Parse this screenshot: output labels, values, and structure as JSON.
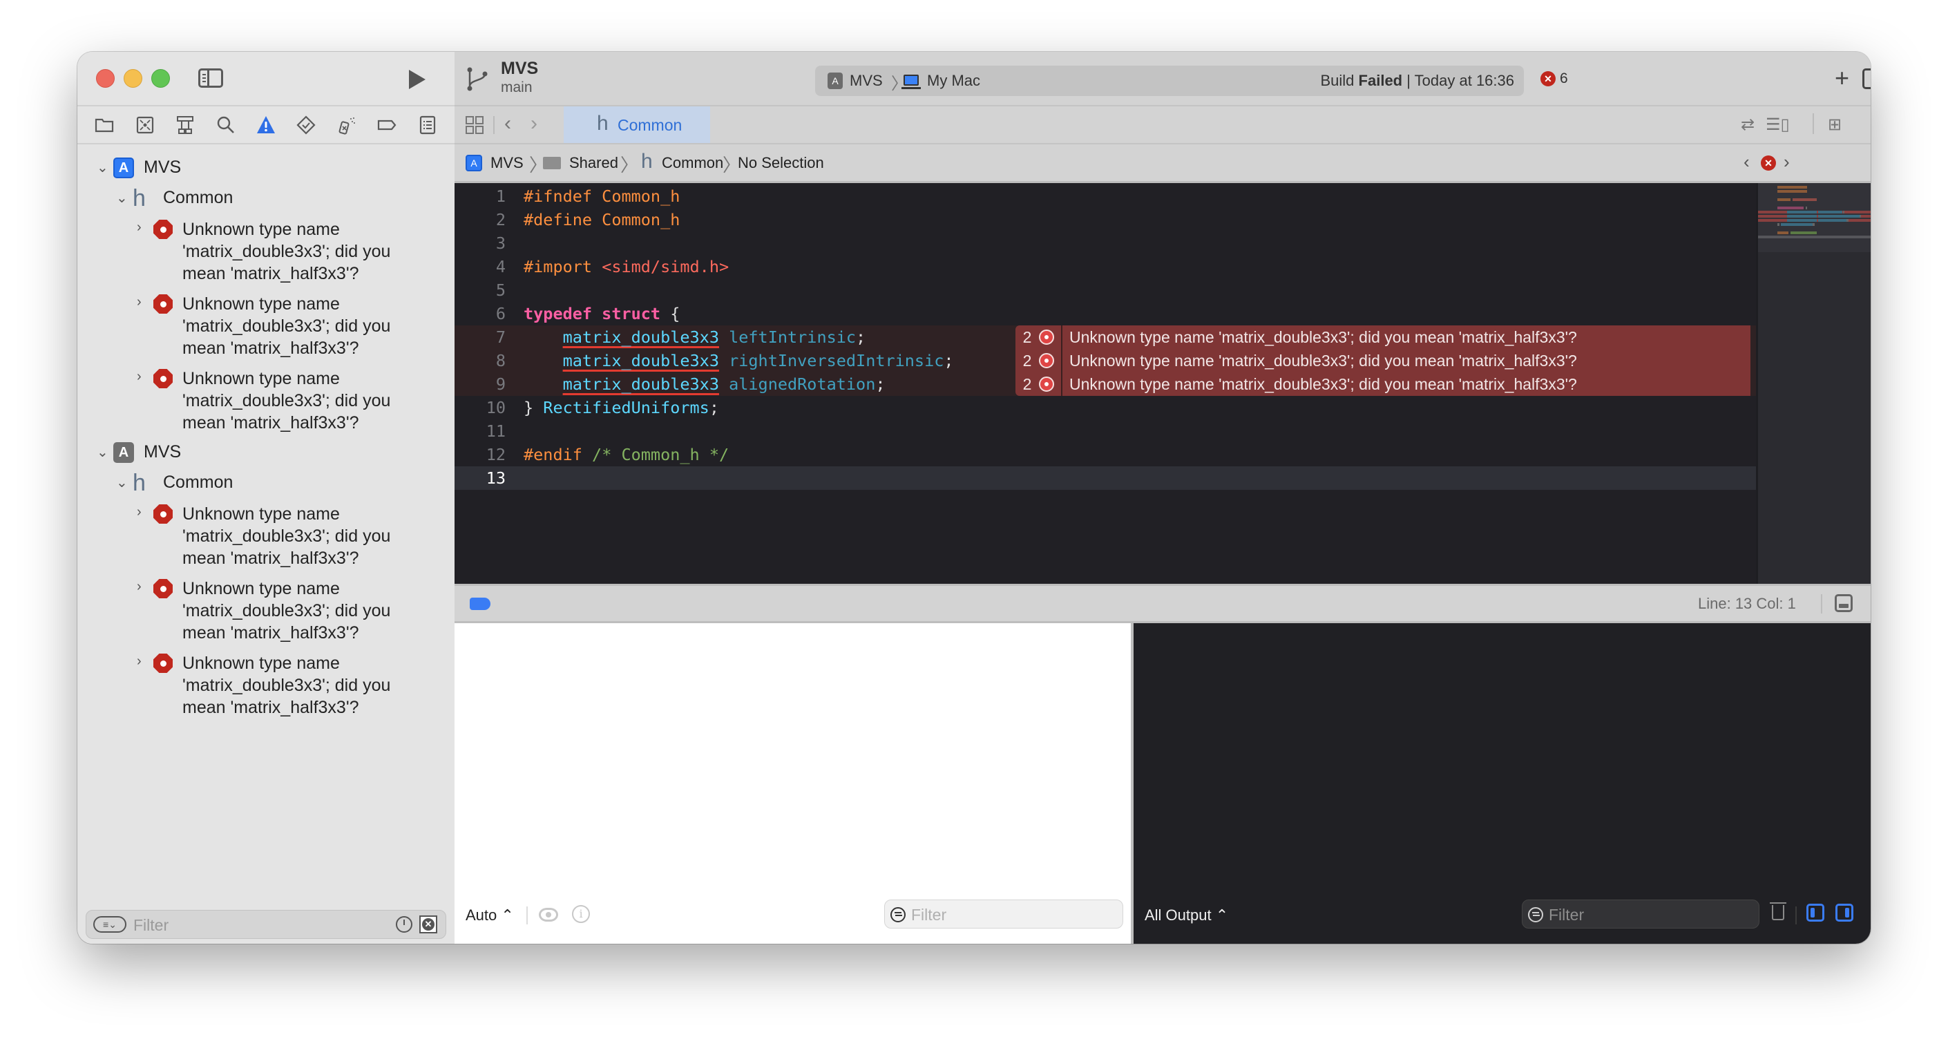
{
  "window": {
    "scheme": {
      "name": "MVS",
      "branch": "main"
    },
    "activity": {
      "target": "MVS",
      "destination": "My Mac",
      "status_prefix": "Build ",
      "status_bold": "Failed",
      "status_suffix": " | Today at 16:36"
    },
    "error_count": "6"
  },
  "navigator": {
    "tabs": [
      {
        "name": "project-navigator",
        "icon": "folder-icon"
      },
      {
        "name": "source-control-navigator",
        "icon": "source-control-icon"
      },
      {
        "name": "symbol-navigator",
        "icon": "hierarchy-icon"
      },
      {
        "name": "find-navigator",
        "icon": "search-icon"
      },
      {
        "name": "issue-navigator",
        "icon": "warning-icon",
        "active": true
      },
      {
        "name": "test-navigator",
        "icon": "test-diamond-icon"
      },
      {
        "name": "debug-navigator",
        "icon": "spray-icon"
      },
      {
        "name": "breakpoint-navigator",
        "icon": "breakpoint-icon"
      },
      {
        "name": "report-navigator",
        "icon": "report-list-icon"
      }
    ],
    "groups": [
      {
        "project": "MVS",
        "project_icon": "app-blue",
        "file": "Common",
        "issues": [
          "Unknown type name 'matrix_double3x3'; did you mean 'matrix_half3x3'?",
          "Unknown type name 'matrix_double3x3'; did you mean 'matrix_half3x3'?",
          "Unknown type name 'matrix_double3x3'; did you mean 'matrix_half3x3'?"
        ]
      },
      {
        "project": "MVS",
        "project_icon": "app-gray",
        "file": "Common",
        "issues": [
          "Unknown type name 'matrix_double3x3'; did you mean 'matrix_half3x3'?",
          "Unknown type name 'matrix_double3x3'; did you mean 'matrix_half3x3'?",
          "Unknown type name 'matrix_double3x3'; did you mean 'matrix_half3x3'?"
        ]
      }
    ],
    "filter_placeholder": "Filter"
  },
  "editor": {
    "tab": {
      "label": "Common",
      "icon": "h"
    },
    "jumpbar": [
      "MVS",
      "Shared",
      "Common",
      "No Selection"
    ],
    "lines": [
      {
        "n": "1",
        "tokens": [
          [
            "kw-pre",
            "#ifndef Common_h"
          ]
        ]
      },
      {
        "n": "2",
        "tokens": [
          [
            "kw-pre",
            "#define Common_h"
          ]
        ]
      },
      {
        "n": "3",
        "tokens": []
      },
      {
        "n": "4",
        "tokens": [
          [
            "kw-pre",
            "#import "
          ],
          [
            "str",
            "<simd/simd.h>"
          ]
        ]
      },
      {
        "n": "5",
        "tokens": []
      },
      {
        "n": "6",
        "tokens": [
          [
            "kw",
            "typedef struct"
          ],
          [
            "punct",
            " {"
          ]
        ]
      },
      {
        "n": "7",
        "error": true,
        "tokens": [
          [
            "punct",
            "    "
          ],
          [
            "type-err",
            "matrix_double3x3"
          ],
          [
            "ident2",
            " leftIntrinsic"
          ],
          [
            "punct",
            ";"
          ]
        ]
      },
      {
        "n": "8",
        "error": true,
        "tokens": [
          [
            "punct",
            "    "
          ],
          [
            "type-err",
            "matrix_double3x3"
          ],
          [
            "ident2",
            " rightInversedIntrinsic"
          ],
          [
            "punct",
            ";"
          ]
        ]
      },
      {
        "n": "9",
        "error": true,
        "tokens": [
          [
            "punct",
            "    "
          ],
          [
            "type-err",
            "matrix_double3x3"
          ],
          [
            "ident2",
            " alignedRotation"
          ],
          [
            "punct",
            ";"
          ]
        ]
      },
      {
        "n": "10",
        "tokens": [
          [
            "punct",
            "} "
          ],
          [
            "typ",
            "RectifiedUniforms"
          ],
          [
            "punct",
            ";"
          ]
        ]
      },
      {
        "n": "11",
        "tokens": []
      },
      {
        "n": "12",
        "tokens": [
          [
            "kw-pre",
            "#endif "
          ],
          [
            "cmt-green",
            "/* Common_h */"
          ]
        ]
      },
      {
        "n": "13",
        "current": true,
        "tokens": []
      }
    ],
    "annotations": [
      {
        "line": 7,
        "count": "2",
        "message": "Unknown type name 'matrix_double3x3'; did you mean 'matrix_half3x3'?"
      },
      {
        "line": 8,
        "count": "2",
        "message": "Unknown type name 'matrix_double3x3'; did you mean 'matrix_half3x3'?"
      },
      {
        "line": 9,
        "count": "2",
        "message": "Unknown type name 'matrix_double3x3'; did you mean 'matrix_half3x3'?"
      }
    ],
    "cursor_position": "Line: 13  Col: 1"
  },
  "debug": {
    "variables_scope": "Auto ⌃",
    "variables_filter_placeholder": "Filter",
    "console_output_mode": "All Output ⌃",
    "console_filter_placeholder": "Filter"
  },
  "colors": {
    "accent": "#3a7cf4",
    "error": "#c0271d",
    "error_annotation_bg": "#7f3535",
    "editor_bg": "#212025"
  }
}
